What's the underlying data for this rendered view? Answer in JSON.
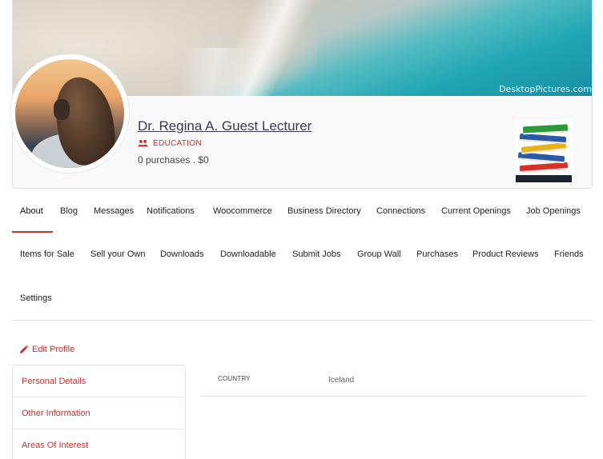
{
  "cover": {
    "watermark": "DesktopPictures.com"
  },
  "profile": {
    "name": "Dr. Regina A. Guest Lecturer",
    "category": "EDUCATION",
    "purchases": "0 purchases . $0"
  },
  "nav": {
    "row1": [
      "About",
      "Blog",
      "Messages",
      "Notifications",
      "Woocommerce",
      "Business Directory",
      "Connections",
      "Current Openings",
      "Job Openings"
    ],
    "row2": [
      "Items for Sale",
      "Sell your Own",
      "Downloads",
      "Downloadable",
      "Submit Jobs",
      "Group Wall",
      "Purchases",
      "Product Reviews",
      "Friends"
    ],
    "row3": [
      "Settings"
    ],
    "active": "About"
  },
  "edit_profile": "Edit Profile",
  "side_menu": [
    "Personal Details",
    "Other Information",
    "Areas Of Interest"
  ],
  "details": [
    {
      "label": "COUNTRY",
      "value": "Iceland"
    }
  ],
  "colors": {
    "accent": "#c9302c",
    "name_link": "#3a3a55",
    "border": "#e2e2e2"
  }
}
